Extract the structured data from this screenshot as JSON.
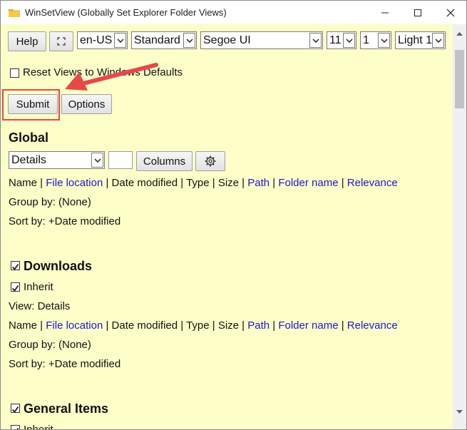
{
  "window": {
    "title": "WinSetView (Globally Set Explorer Folder Views)"
  },
  "toolbar": {
    "help_label": "Help",
    "fullscreen_icon": "fullscreen-icon",
    "language": "en-US",
    "mode": "Standard",
    "font": "Segoe UI",
    "font_size": "11",
    "spacing": "1",
    "theme": "Light 1"
  },
  "reset_label": "Reset Views to Windows Defaults",
  "submit_label": "Submit",
  "options_label": "Options",
  "global": {
    "heading": "Global",
    "view": "Details",
    "columns_label": "Columns",
    "columns_line": [
      "Name",
      "File location",
      "Date modified",
      "Type",
      "Size",
      "Path",
      "Folder name",
      "Relevance"
    ],
    "group_by": "Group by: (None)",
    "sort_by": "Sort by: +Date modified"
  },
  "downloads": {
    "heading": "Downloads",
    "inherit_label": "Inherit",
    "view": "View: Details",
    "columns_line": [
      "Name",
      "File location",
      "Date modified",
      "Type",
      "Size",
      "Path",
      "Folder name",
      "Relevance"
    ],
    "group_by": "Group by: (None)",
    "sort_by": "Sort by: +Date modified"
  },
  "general_items": {
    "heading": "General Items",
    "inherit_label": "Inherit"
  },
  "colors": {
    "background": "#fefec9",
    "link": "#1a1acc",
    "highlight": "#e8484a"
  }
}
